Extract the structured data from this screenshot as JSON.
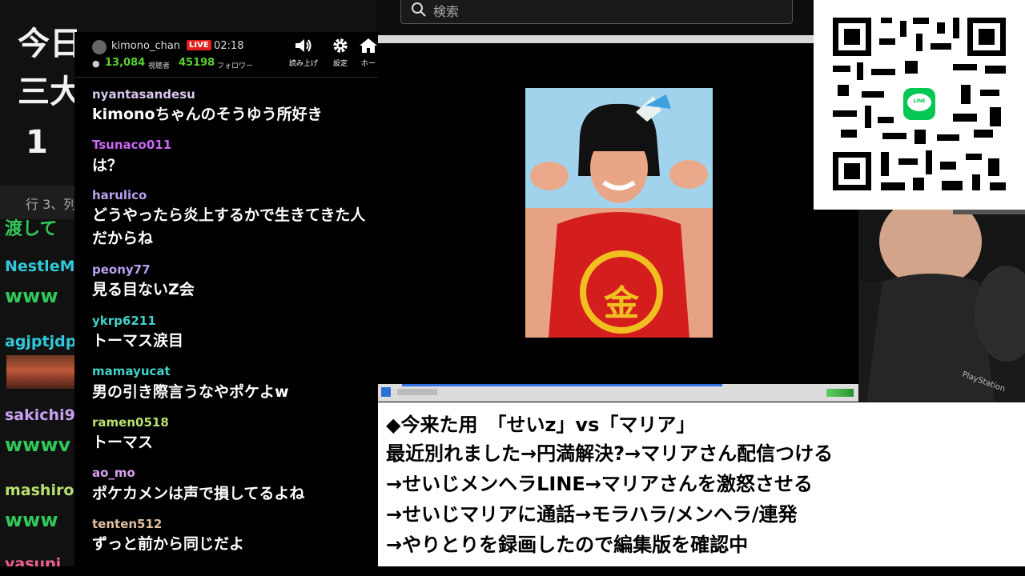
{
  "background_editor": {
    "lines": [
      "今日",
      "三大",
      "1"
    ],
    "status": "行 3、列"
  },
  "side_chat": [
    {
      "user": "渡して",
      "color": "#30c85a"
    },
    {
      "user": "NestleM",
      "color": "#30c8d8"
    },
    {
      "msg": "www"
    },
    {
      "user": "agjptjdp",
      "color": "#30c8d8"
    },
    {
      "user": "sakichi9",
      "color": "#c8a0f0"
    },
    {
      "msg": "wwwv"
    },
    {
      "user": "mashiro",
      "color": "#b8e070"
    },
    {
      "msg": "www"
    },
    {
      "user": "yasupi",
      "color": "#f06090"
    }
  ],
  "chat": {
    "channel_name": "kimono_chan",
    "live_label": "LIVE",
    "elapsed": "02:18",
    "viewers": "13,084",
    "viewers_label": "視聴者",
    "followers": "45198",
    "followers_label": "フォロワー",
    "buttons": [
      {
        "label": "読み上げ",
        "icon": "speaker-icon"
      },
      {
        "label": "設定",
        "icon": "gear-icon"
      },
      {
        "label": "ホー",
        "icon": "home-icon"
      }
    ],
    "messages": [
      {
        "user": "nyantasandesu",
        "color": "#d8c8f0",
        "text": "kimonoちゃんのそうゆう所好き"
      },
      {
        "user": "Tsunaco011",
        "color": "#c868f0",
        "text": "は？"
      },
      {
        "user": "harulico",
        "color": "#b8a0f0",
        "text": "どうやったら炎上するかで生きてきた人だからね"
      },
      {
        "user": "peony77",
        "color": "#b8a0f0",
        "text": "見る目ないZ会"
      },
      {
        "user": "ykrp6211",
        "color": "#40d0c8",
        "text": "トーマス涙目"
      },
      {
        "user": "mamayucat",
        "color": "#40d0c8",
        "text": "男の引き際言うなやポケよw"
      },
      {
        "user": "ramen0518",
        "color": "#b8e070",
        "text": "トーマス"
      },
      {
        "user": "ao_mo",
        "color": "#d8a0f0",
        "text": "ポケカメンは声で損してるよね"
      },
      {
        "user": "tenten512",
        "color": "#e0c0a0",
        "text": "ずっと前から同じだよ"
      }
    ]
  },
  "search": {
    "placeholder": "検索"
  },
  "notes": [
    "◆今来た用　「せいz」vs「マリア」",
    "最近別れました→円満解決?→マリアさん配信つける",
    "→せいじメンヘラLINE→マリアさんを激怒させる",
    "→せいじマリアに通話→モラハラ/メンヘラ/連発",
    "→やりとりを録画したので編集版を確認中"
  ],
  "photo": {
    "shirt_text": "金"
  },
  "qr": {
    "logo_text": "LINE"
  },
  "webcam": {
    "logo_text": "PlayStation"
  }
}
